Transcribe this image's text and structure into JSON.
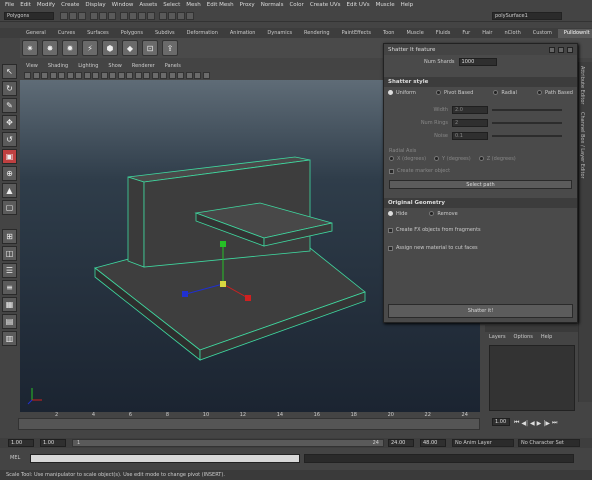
{
  "menu": [
    "File",
    "Edit",
    "Modify",
    "Create",
    "Display",
    "Window",
    "Assets",
    "Select",
    "Mesh",
    "Edit Mesh",
    "Proxy",
    "Normals",
    "Color",
    "Create UVs",
    "Edit UVs",
    "Muscle",
    "Help"
  ],
  "statusline": {
    "mode": "Polygons",
    "object_field": "polySurface1"
  },
  "shelf": {
    "tabs": [
      "General",
      "Curves",
      "Surfaces",
      "Polygons",
      "Subdivs",
      "Deformation",
      "Animation",
      "Dynamics",
      "Rendering",
      "PaintEffects",
      "Toon",
      "Muscle",
      "Fluids",
      "Fur",
      "Hair",
      "nCloth",
      "Custom",
      "PulldownIt"
    ],
    "active_tab": "PulldownIt",
    "icons": [
      "shatter-a-icon",
      "shatter-b-icon",
      "shatter-c-icon",
      "crack-icon",
      "voronoi-icon",
      "dynamic-icon",
      "bake-icon",
      "export-icon"
    ]
  },
  "panel_menu": [
    "View",
    "Shading",
    "Lighting",
    "Show",
    "Renderer",
    "Panels"
  ],
  "right_strip": [
    "Attribute Editor",
    "Channel Box / Layer Editor"
  ],
  "dialog": {
    "title": "Shatter It feature",
    "num_shards_label": "Num Shards",
    "num_shards_value": "1000",
    "section_style": "Shatter style",
    "styles": [
      "Uniform",
      "Pivot Based",
      "Radial",
      "Path Based"
    ],
    "style_selected": "Uniform",
    "params": [
      {
        "label": "Width",
        "value": "2.0"
      },
      {
        "label": "Num Rings",
        "value": "2"
      },
      {
        "label": "Noise",
        "value": "0.1"
      }
    ],
    "radial_axis_label": "Radial Axis",
    "radial_axes": [
      "X (degrees)",
      "Y (degrees)",
      "Z (degrees)"
    ],
    "create_marker_label": "Create marker object",
    "select_path_label": "Select path",
    "section_geometry": "Original Geometry",
    "geometry_options": [
      "Hide",
      "Remove"
    ],
    "geometry_selected": "Hide",
    "create_fx_label": "Create FX objects from fragments",
    "assign_material_label": "Assign new material to cut faces",
    "shatter_button": "Shatter it!"
  },
  "layer_panel": {
    "menu": [
      "Layers",
      "Options",
      "Help"
    ]
  },
  "timeline": {
    "ticks": [
      "2",
      "4",
      "6",
      "8",
      "10",
      "12",
      "14",
      "16",
      "18",
      "20",
      "22",
      "24"
    ],
    "current_frame": "1.00"
  },
  "range": {
    "start": "1.00",
    "start2": "1.00",
    "range_start": "1",
    "range_end": "24",
    "end": "24.00",
    "end2": "48.00",
    "anim_layer": "No Anim Layer",
    "char_set": "No Character Set"
  },
  "mel_label": "MEL",
  "help_text": "Scale Tool: Use manipulator to scale object(s). Use edit mode to change pivot (INSERT).",
  "colors": {
    "accent": "#c04040",
    "grid": "#3fd9a0",
    "object": "#3b3b3b"
  }
}
